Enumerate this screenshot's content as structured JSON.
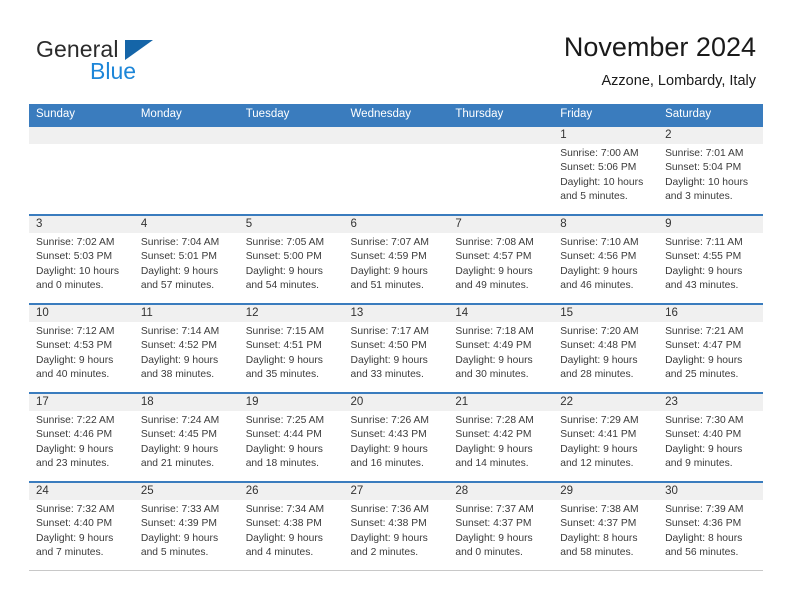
{
  "brand": {
    "name_part1": "General",
    "name_part2": "Blue",
    "logo_icon": "triangle-flag-icon",
    "color_primary": "#1565a8",
    "color_secondary": "#1d86d8"
  },
  "header": {
    "title": "November 2024",
    "subtitle": "Azzone, Lombardy, Italy"
  },
  "theme": {
    "header_bg": "#3a7cbe",
    "daynum_band_bg": "#f0f0f0",
    "row_border": "#3a7cbe",
    "text": "#3b3b3b"
  },
  "calendar": {
    "weekdays": [
      "Sunday",
      "Monday",
      "Tuesday",
      "Wednesday",
      "Thursday",
      "Friday",
      "Saturday"
    ],
    "weeks": [
      [
        {
          "day": "",
          "lines": [
            "",
            "",
            "",
            ""
          ]
        },
        {
          "day": "",
          "lines": [
            "",
            "",
            "",
            ""
          ]
        },
        {
          "day": "",
          "lines": [
            "",
            "",
            "",
            ""
          ]
        },
        {
          "day": "",
          "lines": [
            "",
            "",
            "",
            ""
          ]
        },
        {
          "day": "",
          "lines": [
            "",
            "",
            "",
            ""
          ]
        },
        {
          "day": "1",
          "lines": [
            "Sunrise: 7:00 AM",
            "Sunset: 5:06 PM",
            "Daylight: 10 hours",
            "and 5 minutes."
          ]
        },
        {
          "day": "2",
          "lines": [
            "Sunrise: 7:01 AM",
            "Sunset: 5:04 PM",
            "Daylight: 10 hours",
            "and 3 minutes."
          ]
        }
      ],
      [
        {
          "day": "3",
          "lines": [
            "Sunrise: 7:02 AM",
            "Sunset: 5:03 PM",
            "Daylight: 10 hours",
            "and 0 minutes."
          ]
        },
        {
          "day": "4",
          "lines": [
            "Sunrise: 7:04 AM",
            "Sunset: 5:01 PM",
            "Daylight: 9 hours",
            "and 57 minutes."
          ]
        },
        {
          "day": "5",
          "lines": [
            "Sunrise: 7:05 AM",
            "Sunset: 5:00 PM",
            "Daylight: 9 hours",
            "and 54 minutes."
          ]
        },
        {
          "day": "6",
          "lines": [
            "Sunrise: 7:07 AM",
            "Sunset: 4:59 PM",
            "Daylight: 9 hours",
            "and 51 minutes."
          ]
        },
        {
          "day": "7",
          "lines": [
            "Sunrise: 7:08 AM",
            "Sunset: 4:57 PM",
            "Daylight: 9 hours",
            "and 49 minutes."
          ]
        },
        {
          "day": "8",
          "lines": [
            "Sunrise: 7:10 AM",
            "Sunset: 4:56 PM",
            "Daylight: 9 hours",
            "and 46 minutes."
          ]
        },
        {
          "day": "9",
          "lines": [
            "Sunrise: 7:11 AM",
            "Sunset: 4:55 PM",
            "Daylight: 9 hours",
            "and 43 minutes."
          ]
        }
      ],
      [
        {
          "day": "10",
          "lines": [
            "Sunrise: 7:12 AM",
            "Sunset: 4:53 PM",
            "Daylight: 9 hours",
            "and 40 minutes."
          ]
        },
        {
          "day": "11",
          "lines": [
            "Sunrise: 7:14 AM",
            "Sunset: 4:52 PM",
            "Daylight: 9 hours",
            "and 38 minutes."
          ]
        },
        {
          "day": "12",
          "lines": [
            "Sunrise: 7:15 AM",
            "Sunset: 4:51 PM",
            "Daylight: 9 hours",
            "and 35 minutes."
          ]
        },
        {
          "day": "13",
          "lines": [
            "Sunrise: 7:17 AM",
            "Sunset: 4:50 PM",
            "Daylight: 9 hours",
            "and 33 minutes."
          ]
        },
        {
          "day": "14",
          "lines": [
            "Sunrise: 7:18 AM",
            "Sunset: 4:49 PM",
            "Daylight: 9 hours",
            "and 30 minutes."
          ]
        },
        {
          "day": "15",
          "lines": [
            "Sunrise: 7:20 AM",
            "Sunset: 4:48 PM",
            "Daylight: 9 hours",
            "and 28 minutes."
          ]
        },
        {
          "day": "16",
          "lines": [
            "Sunrise: 7:21 AM",
            "Sunset: 4:47 PM",
            "Daylight: 9 hours",
            "and 25 minutes."
          ]
        }
      ],
      [
        {
          "day": "17",
          "lines": [
            "Sunrise: 7:22 AM",
            "Sunset: 4:46 PM",
            "Daylight: 9 hours",
            "and 23 minutes."
          ]
        },
        {
          "day": "18",
          "lines": [
            "Sunrise: 7:24 AM",
            "Sunset: 4:45 PM",
            "Daylight: 9 hours",
            "and 21 minutes."
          ]
        },
        {
          "day": "19",
          "lines": [
            "Sunrise: 7:25 AM",
            "Sunset: 4:44 PM",
            "Daylight: 9 hours",
            "and 18 minutes."
          ]
        },
        {
          "day": "20",
          "lines": [
            "Sunrise: 7:26 AM",
            "Sunset: 4:43 PM",
            "Daylight: 9 hours",
            "and 16 minutes."
          ]
        },
        {
          "day": "21",
          "lines": [
            "Sunrise: 7:28 AM",
            "Sunset: 4:42 PM",
            "Daylight: 9 hours",
            "and 14 minutes."
          ]
        },
        {
          "day": "22",
          "lines": [
            "Sunrise: 7:29 AM",
            "Sunset: 4:41 PM",
            "Daylight: 9 hours",
            "and 12 minutes."
          ]
        },
        {
          "day": "23",
          "lines": [
            "Sunrise: 7:30 AM",
            "Sunset: 4:40 PM",
            "Daylight: 9 hours",
            "and 9 minutes."
          ]
        }
      ],
      [
        {
          "day": "24",
          "lines": [
            "Sunrise: 7:32 AM",
            "Sunset: 4:40 PM",
            "Daylight: 9 hours",
            "and 7 minutes."
          ]
        },
        {
          "day": "25",
          "lines": [
            "Sunrise: 7:33 AM",
            "Sunset: 4:39 PM",
            "Daylight: 9 hours",
            "and 5 minutes."
          ]
        },
        {
          "day": "26",
          "lines": [
            "Sunrise: 7:34 AM",
            "Sunset: 4:38 PM",
            "Daylight: 9 hours",
            "and 4 minutes."
          ]
        },
        {
          "day": "27",
          "lines": [
            "Sunrise: 7:36 AM",
            "Sunset: 4:38 PM",
            "Daylight: 9 hours",
            "and 2 minutes."
          ]
        },
        {
          "day": "28",
          "lines": [
            "Sunrise: 7:37 AM",
            "Sunset: 4:37 PM",
            "Daylight: 9 hours",
            "and 0 minutes."
          ]
        },
        {
          "day": "29",
          "lines": [
            "Sunrise: 7:38 AM",
            "Sunset: 4:37 PM",
            "Daylight: 8 hours",
            "and 58 minutes."
          ]
        },
        {
          "day": "30",
          "lines": [
            "Sunrise: 7:39 AM",
            "Sunset: 4:36 PM",
            "Daylight: 8 hours",
            "and 56 minutes."
          ]
        }
      ]
    ]
  }
}
